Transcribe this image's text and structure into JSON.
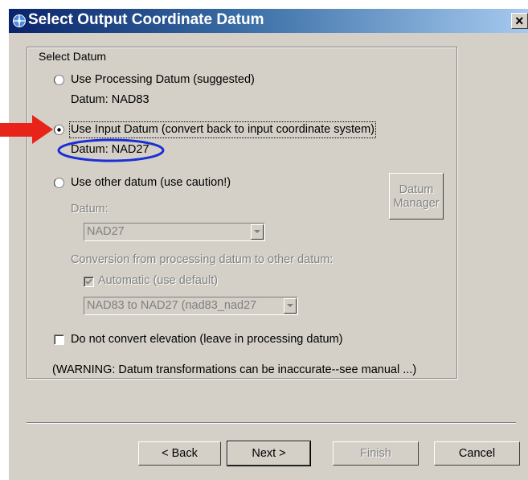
{
  "window": {
    "title": "Select Output Coordinate Datum",
    "close_label": "×"
  },
  "group": {
    "legend": "Select Datum"
  },
  "options": {
    "processing": {
      "label": "Use Processing Datum (suggested)",
      "datum": "Datum: NAD83",
      "selected": false
    },
    "input": {
      "label": "Use Input Datum (convert back to input coordinate system)",
      "datum": "Datum: NAD27",
      "selected": true
    },
    "other": {
      "label": "Use other datum (use caution!)",
      "selected": false
    }
  },
  "other_datum": {
    "datum_label": "Datum:",
    "datum_value": "NAD27",
    "conversion_label": "Conversion from processing datum to other datum:",
    "automatic_label": "Automatic (use default)",
    "automatic_checked": true,
    "conversion_value": "NAD83 to NAD27 (nad83_nad27",
    "manager_button_line1": "Datum",
    "manager_button_line2": "Manager"
  },
  "elevation": {
    "label": "Do not convert elevation (leave in processing datum)",
    "checked": false
  },
  "warning": "(WARNING: Datum transformations can be inaccurate--see manual ...)",
  "buttons": {
    "back": "< Back",
    "next": "Next >",
    "finish": "Finish",
    "cancel": "Cancel"
  },
  "annotations": {
    "arrow_color": "#e8231a",
    "ellipse_color": "#1a2fd4"
  }
}
